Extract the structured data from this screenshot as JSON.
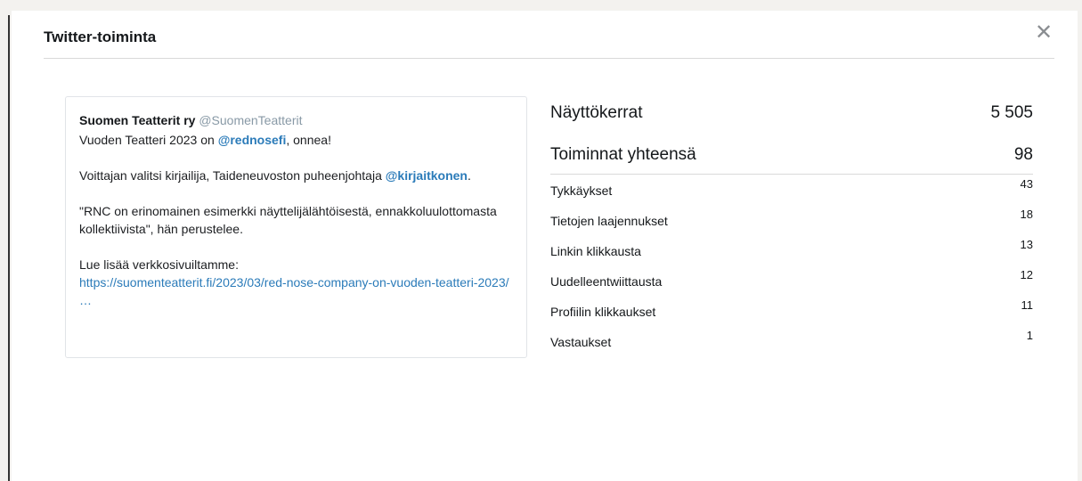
{
  "modal": {
    "title": "Twitter-toiminta",
    "close_symbol": "✕"
  },
  "tweet": {
    "author_name": "Suomen Teatterit ry",
    "author_handle": "@SuomenTeatterit",
    "line1_prefix": "Vuoden Teatteri 2023 on ",
    "line1_mention": "@rednosefi",
    "line1_suffix": ", onnea!",
    "para2_text": "Voittajan valitsi kirjailija, Taideneuvoston puheenjohtaja ",
    "para2_mention": "@kirjaitkonen",
    "para2_suffix": ".",
    "para3_text": "\"RNC on erinomainen esimerkki näyttelijälähtöisestä, ennakkoluulottomasta kollektiivista\", hän perustelee.",
    "para4_text": "Lue lisää verkkosivuiltamme:",
    "para4_link": "https://suomenteatterit.fi/2023/03/red-nose-company-on-vuoden-teatteri-2023/ …"
  },
  "stats": {
    "impressions": {
      "label": "Näyttökerrat",
      "value": "5 505"
    },
    "total_engagements": {
      "label": "Toiminnat yhteensä",
      "value": "98"
    },
    "rows": [
      {
        "label": "Tykkäykset",
        "value": "43"
      },
      {
        "label": "Tietojen laajennukset",
        "value": "18"
      },
      {
        "label": "Linkin klikkausta",
        "value": "13"
      },
      {
        "label": "Uudelleentwiittausta",
        "value": "12"
      },
      {
        "label": "Profiilin klikkaukset",
        "value": "11"
      },
      {
        "label": "Vastaukset",
        "value": "1"
      }
    ]
  },
  "colors": {
    "link": "#2b7bb9",
    "handle": "#8899a6",
    "divider": "#d9d9d9",
    "background": "#f3f2ef"
  }
}
